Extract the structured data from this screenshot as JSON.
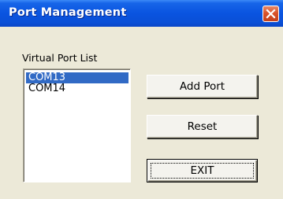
{
  "window": {
    "title": "Port Management",
    "close_icon": "close-x-icon",
    "title_gradient": "#0a54e0",
    "close_color": "#d9532a"
  },
  "list": {
    "caption": "Virtual Port List",
    "items": [
      {
        "label": "COM13",
        "selected": true
      },
      {
        "label": "COM14",
        "selected": false
      }
    ],
    "selection_color": "#316ac5"
  },
  "buttons": {
    "add_port": "Add Port",
    "reset": "Reset",
    "exit": "EXIT"
  }
}
